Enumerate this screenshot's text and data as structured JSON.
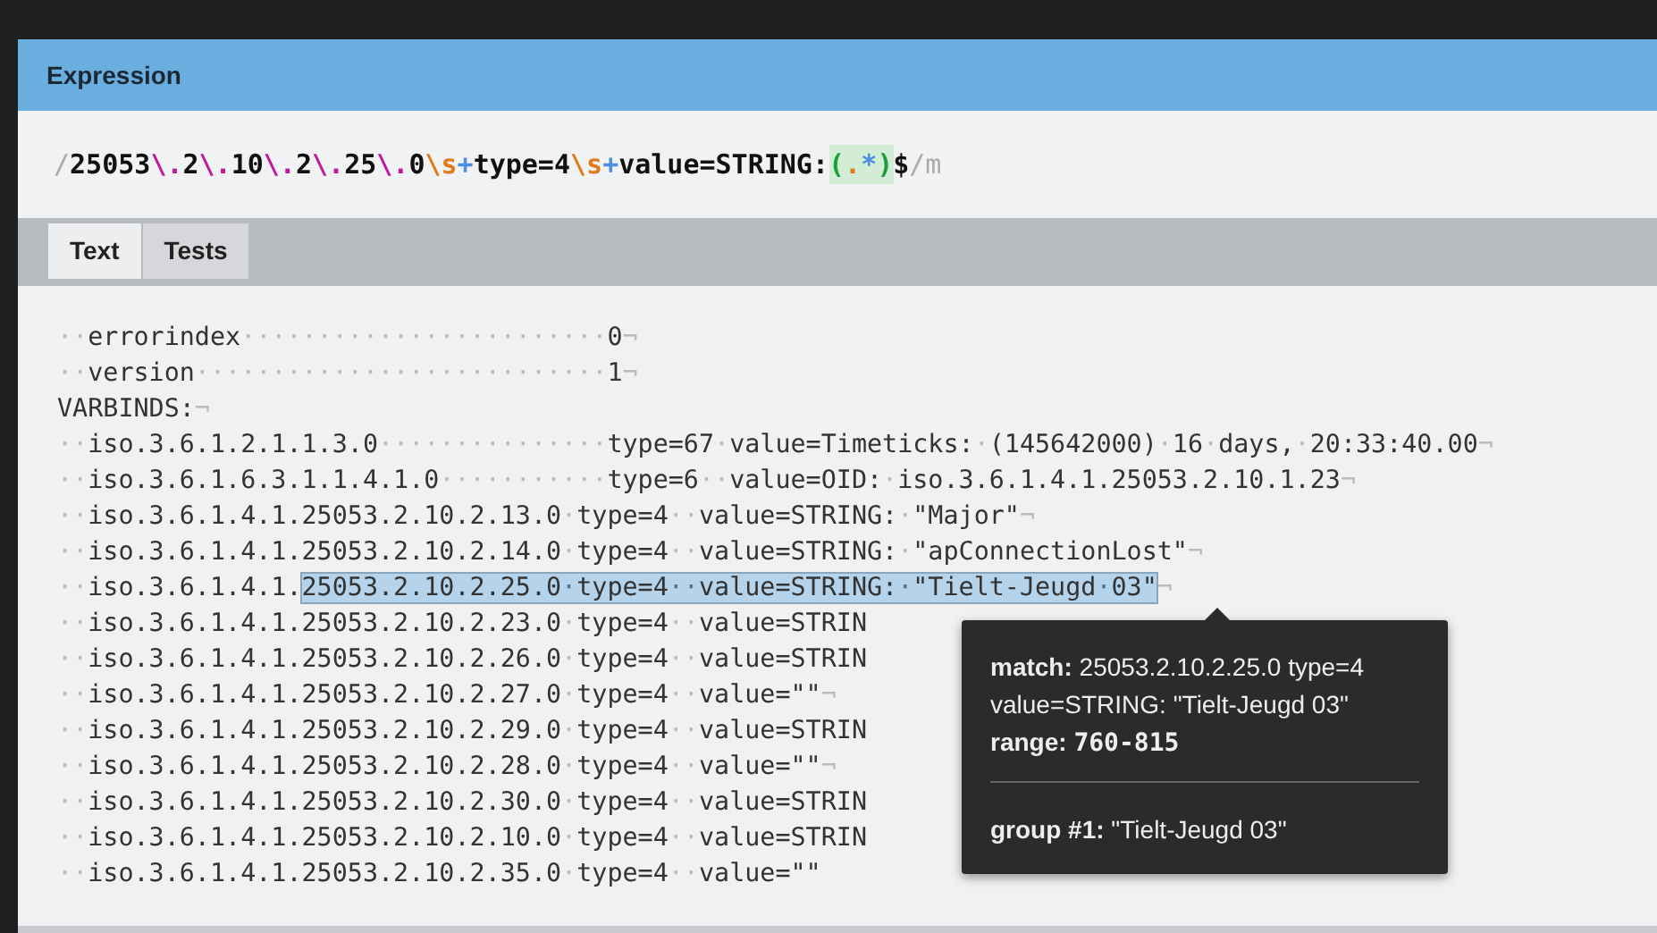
{
  "panel": {
    "title": "Expression"
  },
  "expression": [
    {
      "kind": "delimiter",
      "text": "/"
    },
    {
      "kind": "literal",
      "text": "25053"
    },
    {
      "kind": "escape",
      "text": "\\."
    },
    {
      "kind": "literal",
      "text": "2"
    },
    {
      "kind": "escape",
      "text": "\\."
    },
    {
      "kind": "literal",
      "text": "10"
    },
    {
      "kind": "escape",
      "text": "\\."
    },
    {
      "kind": "literal",
      "text": "2"
    },
    {
      "kind": "escape",
      "text": "\\."
    },
    {
      "kind": "literal",
      "text": "25"
    },
    {
      "kind": "escape",
      "text": "\\."
    },
    {
      "kind": "literal",
      "text": "0"
    },
    {
      "kind": "charclass",
      "text": "\\s"
    },
    {
      "kind": "quantifier",
      "text": "+"
    },
    {
      "kind": "literal",
      "text": "type=4"
    },
    {
      "kind": "charclass",
      "text": "\\s"
    },
    {
      "kind": "quantifier",
      "text": "+"
    },
    {
      "kind": "literal",
      "text": "value=STRING:"
    },
    {
      "kind": "group",
      "text": "("
    },
    {
      "kind": "dot",
      "text": "."
    },
    {
      "kind": "groupquant",
      "text": "*"
    },
    {
      "kind": "group",
      "text": ")"
    },
    {
      "kind": "literal",
      "text": "$"
    },
    {
      "kind": "delimiter",
      "text": "/m"
    }
  ],
  "tabs": [
    {
      "label": "Text",
      "selected": true
    },
    {
      "label": "Tests",
      "selected": false
    }
  ],
  "lines": [
    {
      "text": "··errorindex························0¬"
    },
    {
      "text": "··version···························1¬"
    },
    {
      "text": "VARBINDS:¬"
    },
    {
      "text": "··iso.3.6.1.2.1.1.3.0···············type=67·value=Timeticks:·(145642000)·16·days,·20:33:40.00¬"
    },
    {
      "text": "··iso.3.6.1.6.3.1.1.4.1.0···········type=6··value=OID:·iso.3.6.1.4.1.25053.2.10.1.23¬"
    },
    {
      "text": "··iso.3.6.1.4.1.25053.2.10.2.13.0·type=4··value=STRING:·\"Major\"¬"
    },
    {
      "text": "··iso.3.6.1.4.1.25053.2.10.2.14.0·type=4··value=STRING:·\"apConnectionLost\"¬"
    },
    {
      "text": "··iso.3.6.1.4.1.",
      "match": "25053.2.10.2.25.0·type=4··value=STRING:·\"Tielt-Jeugd·03\"",
      "after": "¬"
    },
    {
      "text": "··iso.3.6.1.4.1.25053.2.10.2.23.0·type=4··value=STRIN"
    },
    {
      "text": "··iso.3.6.1.4.1.25053.2.10.2.26.0·type=4··value=STRIN"
    },
    {
      "text": "··iso.3.6.1.4.1.25053.2.10.2.27.0·type=4··value=\"\"¬"
    },
    {
      "text": "··iso.3.6.1.4.1.25053.2.10.2.29.0·type=4··value=STRIN"
    },
    {
      "text": "··iso.3.6.1.4.1.25053.2.10.2.28.0·type=4··value=\"\"¬"
    },
    {
      "text": "··iso.3.6.1.4.1.25053.2.10.2.30.0·type=4··value=STRIN"
    },
    {
      "text": "··iso.3.6.1.4.1.25053.2.10.2.10.0·type=4··value=STRIN"
    },
    {
      "text": "··iso.3.6.1.4.1.25053.2.10.2.35.0·type=4··value=\"\""
    }
  ],
  "tooltip": {
    "match_label": "match:",
    "match_value": "25053.2.10.2.25.0 type=4 value=STRING: \"Tielt-Jeugd 03\"",
    "range_label": "range:",
    "range_value": "760-815",
    "group_label": "group #1:",
    "group_value": "\"Tielt-Jeugd 03\""
  }
}
